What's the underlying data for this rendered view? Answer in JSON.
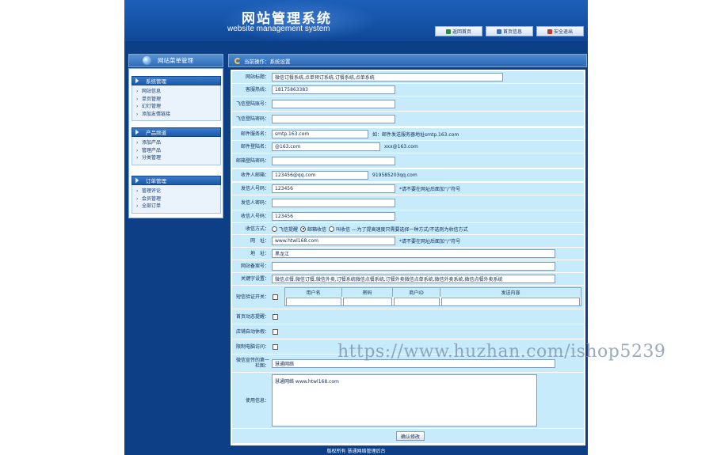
{
  "header": {
    "title": "网站管理系统",
    "subtitle": "website management system",
    "tabs": [
      {
        "label": "返回首页",
        "color": "#2e8b3d",
        "icon": "home-icon"
      },
      {
        "label": "首页信息",
        "color": "#3b6fc0",
        "icon": "info-icon"
      },
      {
        "label": "安全退出",
        "color": "#c0392b",
        "icon": "logout-icon"
      }
    ]
  },
  "sidebar": {
    "title": "网站菜单管理",
    "sections": [
      {
        "title": "系统管理",
        "items": [
          "网站信息",
          "单页管理",
          "幻灯管理",
          "添加友情链接"
        ]
      },
      {
        "title": "产品频道",
        "items": [
          "添加产品",
          "管理产品",
          "分类管理"
        ]
      },
      {
        "title": "订单管理",
        "items": [
          "管理评论",
          "会员管理",
          "全部订单"
        ]
      }
    ]
  },
  "main": {
    "breadcrumb": "当前操作：系统设置",
    "fields": {
      "site_title": {
        "label": "网站标题：",
        "value": "微信订餐系统,点单预订系统,订餐系统,点单系统"
      },
      "hotline": {
        "label": "客服热线：",
        "value": "18175863383"
      },
      "fetion_account": {
        "label": "飞信登陆账号：",
        "value": ""
      },
      "fetion_password": {
        "label": "飞信登陆密码：",
        "value": ""
      },
      "mail_server": {
        "label": "邮件服务名：",
        "value": "smtp.163.com",
        "hint": "如：邮件发送服务器地址smtp.163.com"
      },
      "mail_account": {
        "label": "邮件登陆名：",
        "value": "@163.com",
        "hint": "xxx@163.com"
      },
      "mail_password": {
        "label": "邮箱登陆密码：",
        "value": ""
      },
      "receiver_mail": {
        "label": "收件人邮箱：",
        "value": "123456@qq.com",
        "hint": "919585203qq.com"
      },
      "sender_number": {
        "label": "发信人号码：",
        "value": "123456",
        "hint": "*请不要在网址后面加“/”符号"
      },
      "sender_password": {
        "label": "发信人密码：",
        "value": ""
      },
      "receiver_number": {
        "label": "收信人号码：",
        "value": "123456"
      },
      "receive_method": {
        "label": "收信方式：",
        "options": [
          "飞信提醒",
          "邮箱收信",
          "叫收信"
        ],
        "selected": 1,
        "hint": "---为了提高速度只需要选择一种方式/不选则为收信方式"
      },
      "site_url": {
        "label": "网　址：",
        "value": "www.htwl168.com",
        "hint": "*请不要在网址后面加“/”符号"
      },
      "address": {
        "label": "地　址：",
        "value": "黑龙江"
      },
      "record_no": {
        "label": "网站备案号：",
        "value": ""
      },
      "keywords": {
        "label": "关键字设置：",
        "value": "微信点餐,微信订餐,微信外卖,订餐系统微信点餐系统,订餐外卖微信点单系统,微信外卖系统,微信点餐外卖系统"
      },
      "sms_verify": {
        "label": "短信验证开关：",
        "columns": [
          "用户名",
          "密码",
          "商户ID",
          "发送内容"
        ]
      },
      "home_anim": {
        "label": "首页动态提醒：",
        "checked": false
      },
      "auto_receive": {
        "label": "店铺自动休假：",
        "checked": false
      },
      "pc_access": {
        "label": "限制电脑访问：",
        "checked": false
      },
      "wechat_promo": {
        "label": "微信宣传的第一栏图：",
        "value": "慧通网络"
      },
      "copyright": {
        "label": "使用信息：",
        "value": "慧通网络 www.htwl168.com"
      }
    },
    "submit_label": "确认修改"
  },
  "footer": {
    "text": "版权所有 慧通网络管理后台"
  },
  "watermark": "https://www.huzhan.com/ishop5239"
}
